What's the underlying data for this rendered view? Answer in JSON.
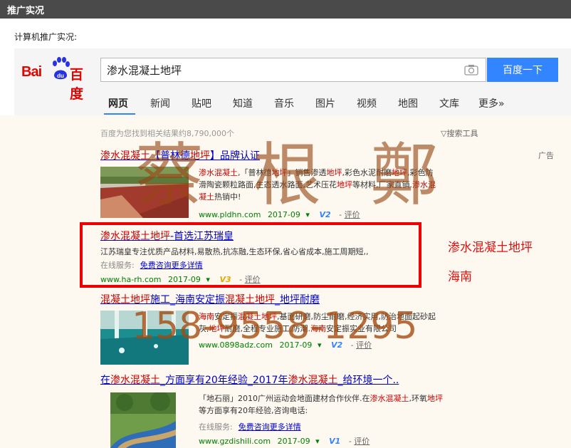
{
  "topbar": {
    "title": "推广实况"
  },
  "subtitle": "计算机推广实况:",
  "logo": {
    "latin": "Bai",
    "du": "du",
    "cn": "百度"
  },
  "search": {
    "query": "渗水混凝土地坪",
    "button": "百度一下"
  },
  "tabs": [
    "网页",
    "新闻",
    "贴吧",
    "知道",
    "音乐",
    "图片",
    "视频",
    "地图",
    "文库",
    "更多»"
  ],
  "stats": "百度为您找到相关结果约8,790,000个",
  "tools": "▽搜索工具",
  "ad_label": "广告",
  "results": [
    {
      "title_parts": [
        [
          "渗水混凝土",
          true
        ],
        [
          "【普林德",
          false
        ],
        [
          "地坪",
          true
        ],
        [
          "】品牌认证",
          false
        ]
      ],
      "desc_lines": [
        [
          [
            "渗水混凝土",
            true
          ],
          [
            ",「普林德",
            false
          ],
          [
            "地坪",
            true
          ],
          [
            "」销售渗透",
            false
          ],
          [
            "地坪",
            true
          ],
          [
            ",彩色水泥耐磨",
            false
          ],
          [
            "地坪",
            true
          ],
          [
            ",彩色防",
            false
          ]
        ],
        [
          [
            "滑陶瓷颗粒路面,生态透水路面,艺术压花",
            false
          ],
          [
            "地坪",
            true
          ],
          [
            "等材料,厂家直销.",
            false
          ],
          [
            "渗水混",
            true
          ]
        ],
        [
          [
            "凝土",
            true
          ],
          [
            "热销中!",
            false
          ]
        ]
      ],
      "url": "www.pldhn.com",
      "date": "2017-09",
      "v": "V2",
      "eval": "评价"
    },
    {
      "title_parts": [
        [
          "渗水混凝土地坪",
          true
        ],
        [
          "-首选江苏瑞皇",
          false
        ]
      ],
      "desc_lines": [
        [
          [
            "江苏瑞皇专注优质产品材料,易散热,抗冻融,生态环保,省心省成本,施工周期短,,",
            false
          ]
        ]
      ],
      "online_label": "在线服务:",
      "online_link": "免费咨询更多详情",
      "url": "www.ha-rh.com",
      "date": "2017-09",
      "v": "V3",
      "eval": "评价"
    },
    {
      "title_parts": [
        [
          "混凝土地坪",
          true
        ],
        [
          "施工_海南安定振",
          false
        ],
        [
          "混凝土地坪",
          true
        ],
        [
          "_地坪耐磨",
          false
        ]
      ],
      "desc_lines": [
        [
          [
            "海南",
            true
          ],
          [
            "安定振",
            false
          ],
          [
            "混凝土地坪",
            true
          ],
          [
            ",基面研磨,防尘耐磨,经济实用,防治地面起砂起",
            false
          ]
        ],
        [
          [
            "灰,",
            false
          ],
          [
            "地坪",
            true
          ],
          [
            "耐磨,全程专业施工,防潮.",
            false
          ],
          [
            "海南",
            true
          ],
          [
            "安定振实业有限公司",
            false
          ]
        ]
      ],
      "url": "www.0898adz.com",
      "date": "2017-09",
      "v": "V2",
      "eval": "评价"
    },
    {
      "title_parts": [
        [
          "在",
          false
        ],
        [
          "渗水混凝土",
          true
        ],
        [
          "_方面享有20年经验_2017年",
          false
        ],
        [
          "渗水混凝土",
          true
        ],
        [
          "_给环境一个..",
          false
        ]
      ],
      "desc_lines": [
        [
          [
            "「地石丽」2010广州运动会地面建材合作伙伴.在",
            false
          ],
          [
            "渗水混凝土",
            true
          ],
          [
            ",环氧",
            false
          ],
          [
            "地坪",
            true
          ]
        ],
        [
          [
            "等方面享有20年经验,咨询电话:",
            false
          ]
        ]
      ],
      "online_label": "在线服务:",
      "online_link": "免费咨询更多详情",
      "url": "www.gzdishili.com",
      "date": "2017-09",
      "v": "V1",
      "eval": "评价"
    }
  ],
  "side_labels": [
    "渗水混凝土地坪",
    "海南"
  ],
  "watermark": {
    "chars": [
      "蔡",
      "根",
      "鄭"
    ],
    "phone": "158-9558-1295"
  },
  "colors": {
    "topbar": "#4a4a4a",
    "link": "#0000cc",
    "highlight": "#c00",
    "url": "#008000",
    "button": "#3385ff",
    "frame": "#ee0000"
  }
}
